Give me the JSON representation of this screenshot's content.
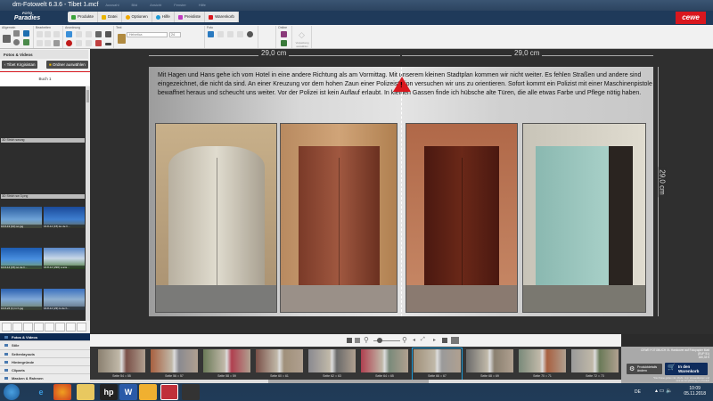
{
  "window": {
    "title": "dm-Fotowelt 6.3.6 - Tibet 1.mcf",
    "menus": [
      "Datei",
      "Auswahl",
      "Bild",
      "Ansicht",
      "Fenster",
      "Hilfe"
    ]
  },
  "logo": {
    "top": "FOTO",
    "main": "Paradies"
  },
  "brand": "cewe",
  "main_menu": [
    {
      "label": "Produkte",
      "color": "#3aa33a"
    },
    {
      "label": "Datei",
      "color": "#e8b400"
    },
    {
      "label": "Optionen",
      "color": "#f0a800"
    },
    {
      "label": "Hilfe",
      "color": "#1e9ad6"
    },
    {
      "label": "Preisliste",
      "color": "#c03cc0"
    },
    {
      "label": "Warenkorb",
      "color": "#d9171e"
    }
  ],
  "toolbar": {
    "groups": [
      "Allgemein",
      "Bearbeiten",
      "Anordnung",
      "Text",
      "Foto",
      "Online"
    ],
    "font": "Helvetica",
    "font_size": "24",
    "online_button": "Verpackung auswählen"
  },
  "left_panel": {
    "title": "Fotos & Videos",
    "back_button": "Tibet Kirgisistan",
    "folder_button": "Ordner auswählen",
    "book": "Buch 1",
    "labels": [
      "3D Strich swung",
      "3D Strich sw 3.png"
    ],
    "photos": [
      "16.8-13 (10) so.jpg",
      "16.8-14 (15) ke de h...",
      "16.8-14 (15) so de h...",
      "16.8-14 (296) a ans...",
      "16.8-24 (1) in h.jpg",
      "16.8-14 (23) to de h..."
    ],
    "menu": [
      "Fotos & Videos",
      "Stile",
      "Seitenlayouts",
      "Hintergründe",
      "Cliparts",
      "Masken & Rahmen"
    ]
  },
  "canvas": {
    "ruler_left": "29,0 cm",
    "ruler_right": "29,0 cm",
    "ruler_vertical": "29,0 cm",
    "text": "Mit Hagen und Hans gehe ich vom Hotel in eine andere Richtung als am Vormittag. Mit unserem kleinen Stadtplan kommen wir nicht weiter. Es fehlen Straßen und andere sind eingezeichnet, die nicht da sind. An einer Kreuzung vor dem hohen Zaun einer Polizeistation versuchen wir uns zu orientieren. Sofort kommt ein Polizist mit einer Maschinenpistole bewaffnet heraus und scheucht uns weiter. Vor der Polizei ist kein Auflauf erlaubt. In kleinen Gassen finde ich hübsche alte Türen, die alle etwas Farbe und Pflege nötig haben."
  },
  "pages": [
    "Seite 54 = 55",
    "Seite 56 = 57",
    "Seite 58 = 59",
    "Seite 60 = 61",
    "Seite 62 = 63",
    "Seite 64 = 65",
    "Seite 66 = 67",
    "Seite 68 = 69",
    "Seite 70 = 71",
    "Seite 72 = 73"
  ],
  "selected_page": "Seite 66 = 67",
  "product": {
    "name": "CEWE FOTOBUCH XL Hardcover auf Fotopapier Matt",
    "pages": "(EUP 51)",
    "price": "180,33 €",
    "details_button": "Produktdetails ändern",
    "cart_button": "In den Warenkorb",
    "note": "*Die Preise gelten inkl. MwSt. zzgl. Versandkosten und sind als Empfehlung pro Produkt"
  },
  "taskbar": {
    "language": "DE",
    "time": "10:09",
    "date": "05.11.2018"
  }
}
